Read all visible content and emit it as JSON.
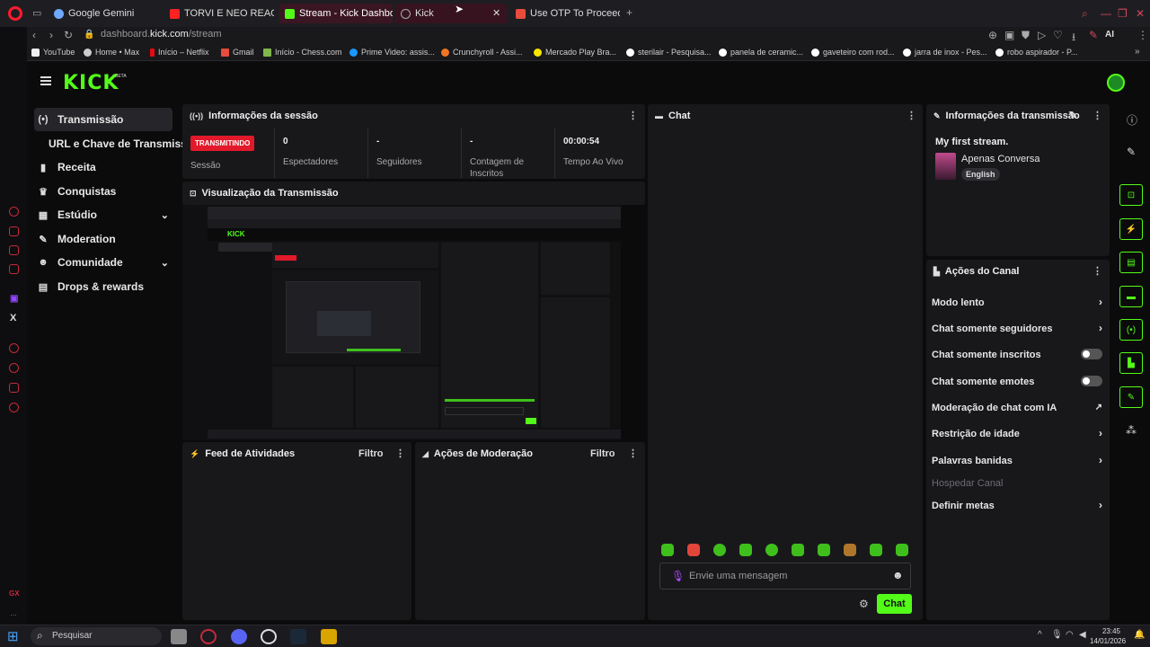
{
  "browser": {
    "tabs": [
      {
        "label": "Google Gemini",
        "color": "#6ea8ff"
      },
      {
        "label": "TORVI E NEO REAGEM AO",
        "color": "#ff2222"
      },
      {
        "label": "Stream - Kick Dashboard",
        "color": "#53fc18"
      },
      {
        "label": "Kick",
        "color": "#888888"
      },
      {
        "label": "Use OTP To Proceed - igo",
        "color": "#e74c3c"
      }
    ],
    "url_prefix": "dashboard.",
    "url_domain": "kick.com",
    "url_path": "/stream",
    "bookmarks": [
      "YouTube",
      "Home • Max",
      "Início – Netflix",
      "Gmail",
      "Início - Chess.com",
      "Prime Video: assis...",
      "Crunchyroll - Assi...",
      "Mercado Play Bra...",
      "sterilair - Pesquisa...",
      "panela de ceramic...",
      "gaveteiro com rod...",
      "jarra de inox - Pes...",
      "robo aspirador - P..."
    ],
    "ai_label": "AI"
  },
  "kick": {
    "logo": "KICK",
    "beta": "BETA",
    "nav": [
      {
        "label": "Transmissão",
        "icon": "(•)"
      },
      {
        "label": "URL e Chave de Transmissão",
        "icon": ""
      },
      {
        "label": "Receita",
        "icon": "▮"
      },
      {
        "label": "Conquistas",
        "icon": "♛"
      },
      {
        "label": "Estúdio",
        "icon": "▦"
      },
      {
        "label": "Moderation",
        "icon": "✎"
      },
      {
        "label": "Comunidade",
        "icon": "☻"
      },
      {
        "label": "Drops & rewards",
        "icon": "▤"
      }
    ]
  },
  "session": {
    "title": "Informações da sessão",
    "live_badge": "TRANSMITINDO",
    "session_label": "Sessão",
    "stats": [
      {
        "value": "0",
        "label": "Espectadores"
      },
      {
        "value": "-",
        "label": "Seguidores"
      },
      {
        "value": "-",
        "label": "Contagem de Inscritos"
      },
      {
        "value": "00:00:54",
        "label": "Tempo Ao Vivo"
      }
    ]
  },
  "preview": {
    "title": "Visualização da Transmissão"
  },
  "activity": {
    "title": "Feed de Atividades",
    "filter": "Filtro"
  },
  "modactions": {
    "title": "Ações de Moderação",
    "filter": "Filtro"
  },
  "chat": {
    "title": "Chat",
    "placeholder": "Envie uma mensagem",
    "send": "Chat"
  },
  "stream_info": {
    "title": "Informações da transmissão",
    "stream_title": "My first stream.",
    "category": "Apenas Conversa",
    "language": "English"
  },
  "channel_actions": {
    "title": "Ações do Canal",
    "items": [
      {
        "label": "Modo lento",
        "kind": "arrow"
      },
      {
        "label": "Chat somente seguidores",
        "kind": "arrow"
      },
      {
        "label": "Chat somente inscritos",
        "kind": "toggle"
      },
      {
        "label": "Chat somente emotes",
        "kind": "toggle"
      },
      {
        "label": "Moderação de chat com IA",
        "kind": "external"
      },
      {
        "label": "Restrição de idade",
        "kind": "arrow"
      },
      {
        "label": "Palavras banidas",
        "kind": "arrow"
      },
      {
        "label": "Hospedar Canal",
        "kind": "disabled"
      },
      {
        "label": "Definir metas",
        "kind": "arrow"
      }
    ]
  },
  "taskbar": {
    "search": "Pesquisar",
    "time": "23:45",
    "date": "14/01/2026"
  }
}
